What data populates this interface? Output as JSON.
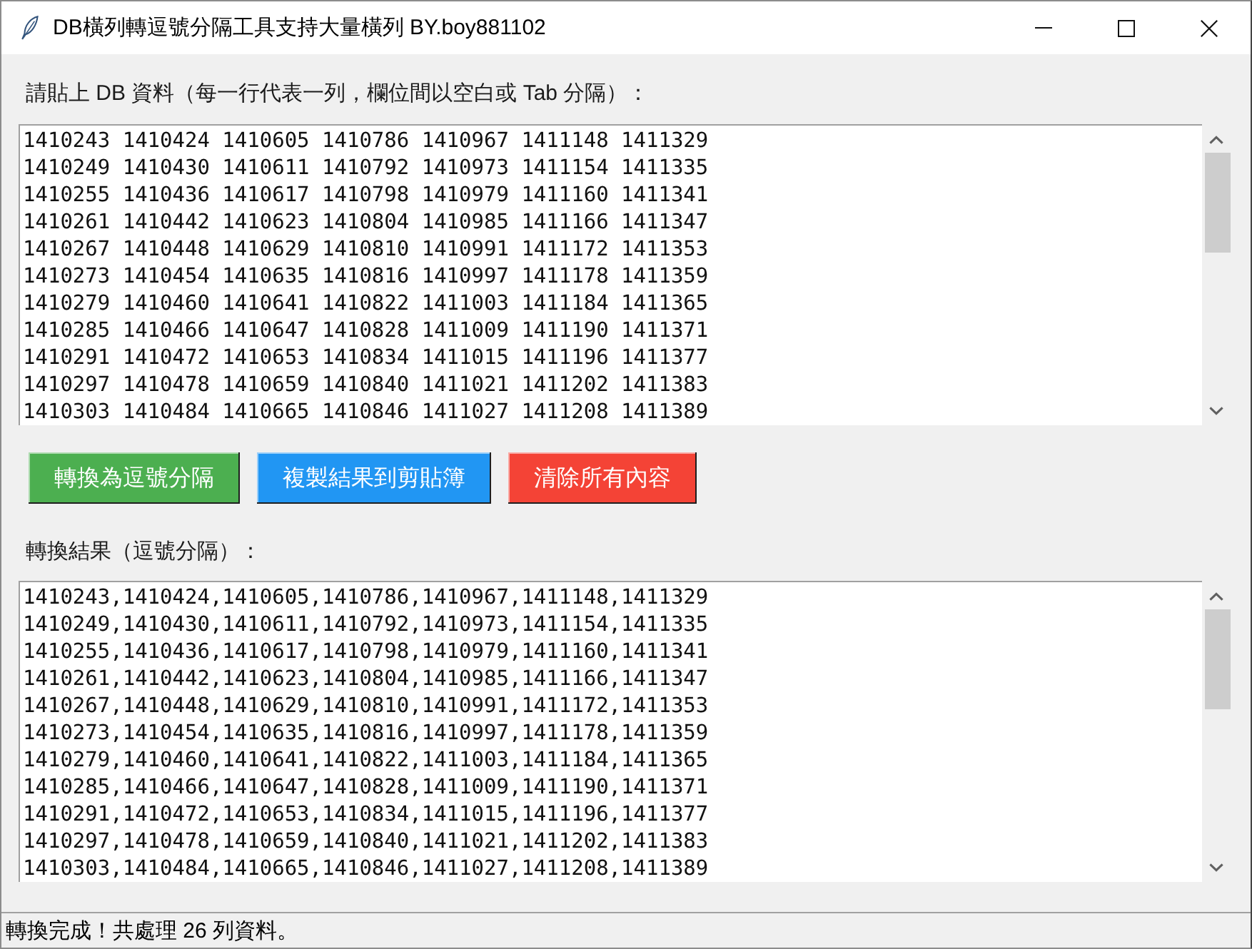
{
  "window": {
    "title": "DB橫列轉逗號分隔工具支持大量橫列 BY.boy881102"
  },
  "input": {
    "label": "請貼上 DB 資料（每一行代表一列，欄位間以空白或 Tab 分隔）：",
    "lines": [
      "1410243 1410424 1410605 1410786 1410967 1411148 1411329",
      "1410249 1410430 1410611 1410792 1410973 1411154 1411335",
      "1410255 1410436 1410617 1410798 1410979 1411160 1411341",
      "1410261 1410442 1410623 1410804 1410985 1411166 1411347",
      "1410267 1410448 1410629 1410810 1410991 1411172 1411353",
      "1410273 1410454 1410635 1410816 1410997 1411178 1411359",
      "1410279 1410460 1410641 1410822 1411003 1411184 1411365",
      "1410285 1410466 1410647 1410828 1411009 1411190 1411371",
      "1410291 1410472 1410653 1410834 1411015 1411196 1411377",
      "1410297 1410478 1410659 1410840 1411021 1411202 1411383",
      "1410303 1410484 1410665 1410846 1411027 1411208 1411389"
    ]
  },
  "buttons": [
    {
      "label": "轉換為逗號分隔",
      "color": "#4caf50"
    },
    {
      "label": "複製結果到剪貼簿",
      "color": "#2196f3"
    },
    {
      "label": "清除所有內容",
      "color": "#f44336"
    }
  ],
  "output": {
    "label": "轉換結果（逗號分隔）：",
    "lines": [
      "1410243,1410424,1410605,1410786,1410967,1411148,1411329",
      "1410249,1410430,1410611,1410792,1410973,1411154,1411335",
      "1410255,1410436,1410617,1410798,1410979,1411160,1411341",
      "1410261,1410442,1410623,1410804,1410985,1411166,1411347",
      "1410267,1410448,1410629,1410810,1410991,1411172,1411353",
      "1410273,1410454,1410635,1410816,1410997,1411178,1411359",
      "1410279,1410460,1410641,1410822,1411003,1411184,1411365",
      "1410285,1410466,1410647,1410828,1411009,1411190,1411371",
      "1410291,1410472,1410653,1410834,1411015,1411196,1411377",
      "1410297,1410478,1410659,1410840,1411021,1411202,1411383",
      "1410303,1410484,1410665,1410846,1411027,1411208,1411389"
    ]
  },
  "status_bar": {
    "text": "轉換完成！共處理 26 列資料。"
  }
}
